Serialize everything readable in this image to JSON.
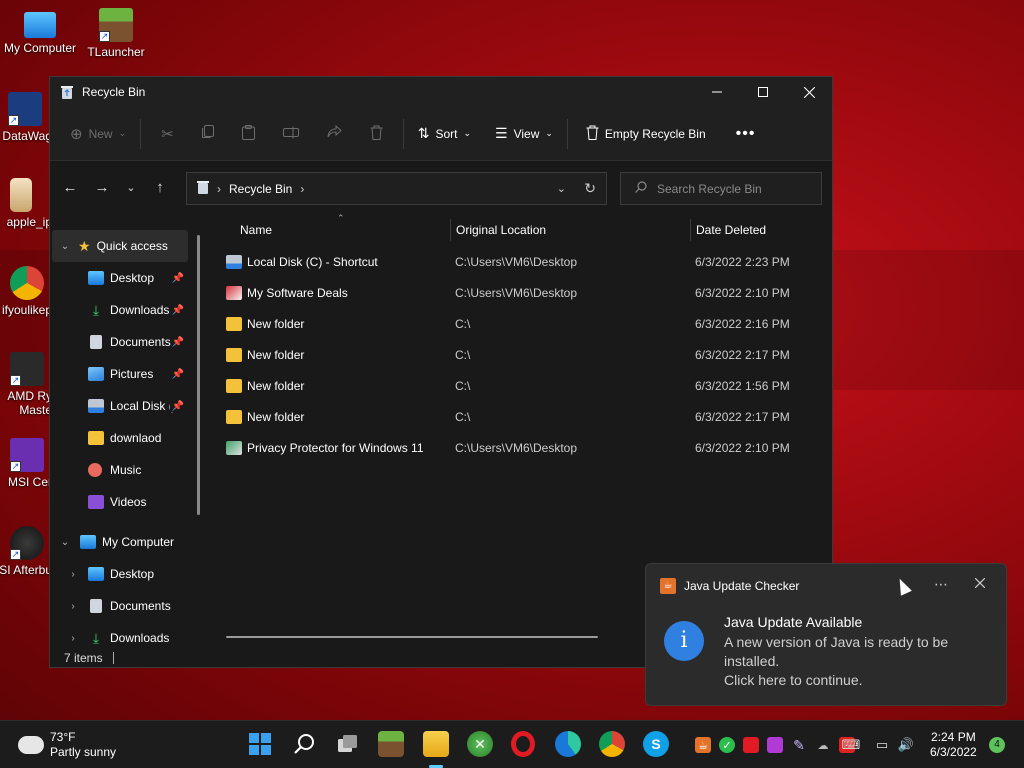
{
  "desktop": {
    "icons": [
      {
        "label": "My Computer"
      },
      {
        "label": "TLauncher"
      },
      {
        "label": "DataWag"
      },
      {
        "label": "apple_ip"
      },
      {
        "label": "ifyoulikep"
      },
      {
        "label": "AMD Ry Maste"
      },
      {
        "label": "MSI Cer"
      },
      {
        "label": "MSI Afterbu"
      }
    ]
  },
  "window": {
    "title": "Recycle Bin",
    "commands": {
      "new_label": "New",
      "sort_label": "Sort",
      "view_label": "View",
      "empty_label": "Empty Recycle Bin"
    },
    "address": {
      "location": "Recycle Bin"
    },
    "search": {
      "placeholder": "Search Recycle Bin"
    },
    "sidebar": {
      "quick_access": "Quick access",
      "quick_items": [
        {
          "label": "Desktop",
          "pinned": true
        },
        {
          "label": "Downloads",
          "pinned": true
        },
        {
          "label": "Documents",
          "pinned": true
        },
        {
          "label": "Pictures",
          "pinned": true
        },
        {
          "label": "Local Disk (C",
          "pinned": true
        },
        {
          "label": "downlaod",
          "pinned": false
        },
        {
          "label": "Music",
          "pinned": false
        },
        {
          "label": "Videos",
          "pinned": false
        }
      ],
      "my_computer": "My Computer",
      "computer_items": [
        {
          "label": "Desktop"
        },
        {
          "label": "Documents"
        },
        {
          "label": "Downloads"
        }
      ]
    },
    "columns": {
      "name": "Name",
      "location": "Original Location",
      "date": "Date Deleted"
    },
    "files": [
      {
        "name": "Local Disk (C) - Shortcut",
        "location": "C:\\Users\\VM6\\Desktop",
        "date": "6/3/2022 2:23 PM",
        "icon": "shortcut-drive-icon"
      },
      {
        "name": "My Software Deals",
        "location": "C:\\Users\\VM6\\Desktop",
        "date": "6/3/2022 2:10 PM",
        "icon": "shortcut-app-icon"
      },
      {
        "name": "New folder",
        "location": "C:\\",
        "date": "6/3/2022 2:16 PM",
        "icon": "folder-icon"
      },
      {
        "name": "New folder",
        "location": "C:\\",
        "date": "6/3/2022 2:17 PM",
        "icon": "folder-icon"
      },
      {
        "name": "New folder",
        "location": "C:\\",
        "date": "6/3/2022 1:56 PM",
        "icon": "folder-icon"
      },
      {
        "name": "New folder",
        "location": "C:\\",
        "date": "6/3/2022 2:17 PM",
        "icon": "folder-icon"
      },
      {
        "name": "Privacy Protector for Windows 11",
        "location": "C:\\Users\\VM6\\Desktop",
        "date": "6/3/2022 2:10 PM",
        "icon": "shortcut-app-icon"
      }
    ],
    "status": {
      "item_count": "7 items"
    }
  },
  "toast": {
    "app_name": "Java Update Checker",
    "title": "Java Update Available",
    "body_line1": "A new version of Java is ready to be",
    "body_line2": "installed.",
    "body_line3": "Click here to continue."
  },
  "taskbar": {
    "weather_temp": "73°F",
    "weather_desc": "Partly sunny",
    "time": "2:24 PM",
    "date": "6/3/2022",
    "notification_count": "4"
  },
  "colors": {
    "accent": "#60cdff",
    "folder": "#f3c13a",
    "window_bg": "#191919",
    "toast_info": "#2f80e0"
  }
}
